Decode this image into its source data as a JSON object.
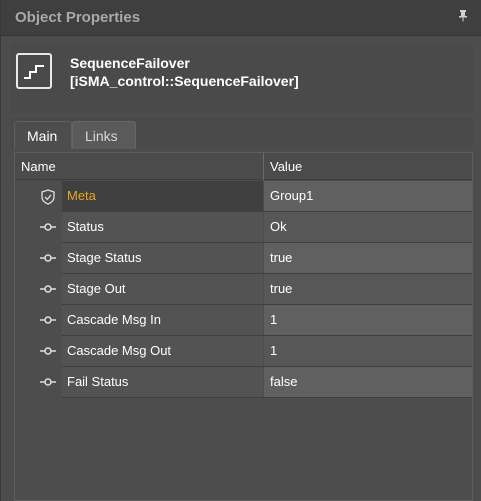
{
  "panel": {
    "title": "Object Properties",
    "pin_icon": "pin-icon"
  },
  "object": {
    "name": "SequenceFailover",
    "type": "[iSMA_control::SequenceFailover]",
    "icon": "sequence-step-icon"
  },
  "tabs": [
    {
      "label": "Main",
      "active": true
    },
    {
      "label": "Links",
      "active": false
    }
  ],
  "grid": {
    "columns": {
      "name": "Name",
      "value": "Value"
    },
    "rows": [
      {
        "name": "Meta",
        "value": "Group1",
        "icon": "shield-check-icon",
        "selected": true
      },
      {
        "name": "Status",
        "value": "Ok",
        "icon": "slot-connector-icon"
      },
      {
        "name": "Stage Status",
        "value": "true",
        "icon": "slot-connector-icon"
      },
      {
        "name": "Stage Out",
        "value": "true",
        "icon": "slot-connector-icon"
      },
      {
        "name": "Cascade Msg In",
        "value": "1",
        "icon": "slot-connector-icon"
      },
      {
        "name": "Cascade Msg Out",
        "value": "1",
        "icon": "slot-connector-icon"
      },
      {
        "name": "Fail Status",
        "value": "false",
        "icon": "slot-connector-icon"
      }
    ]
  },
  "colors": {
    "meta_label": "#e6a623",
    "background": "#4d4d4d"
  }
}
